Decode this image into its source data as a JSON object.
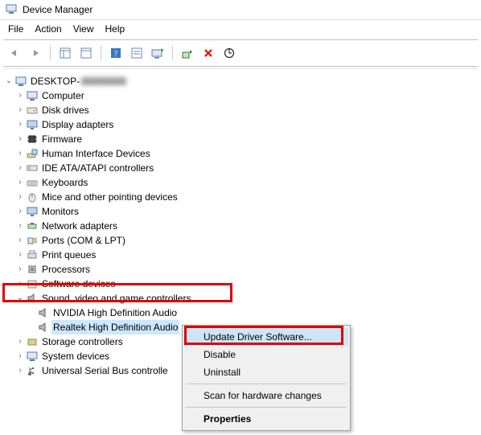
{
  "window": {
    "title": "Device Manager"
  },
  "menu": {
    "file": "File",
    "action": "Action",
    "view": "View",
    "help": "Help"
  },
  "tree": {
    "root": "DESKTOP-",
    "nodes": {
      "computer": "Computer",
      "disk": "Disk drives",
      "display": "Display adapters",
      "firmware": "Firmware",
      "hid": "Human Interface Devices",
      "ide": "IDE ATA/ATAPI controllers",
      "keyboards": "Keyboards",
      "mice": "Mice and other pointing devices",
      "monitors": "Monitors",
      "network": "Network adapters",
      "ports": "Ports (COM & LPT)",
      "printq": "Print queues",
      "processors": "Processors",
      "softdev": "Software devices",
      "sound": "Sound, video and game controllers",
      "nvidia": "NVIDIA High Definition Audio",
      "realtek": "Realtek High Definition Audio",
      "storage": "Storage controllers",
      "system": "System devices",
      "usb": "Universal Serial Bus controlle"
    }
  },
  "context": {
    "update": "Update Driver Software...",
    "disable": "Disable",
    "uninstall": "Uninstall",
    "scan": "Scan for hardware changes",
    "properties": "Properties"
  }
}
